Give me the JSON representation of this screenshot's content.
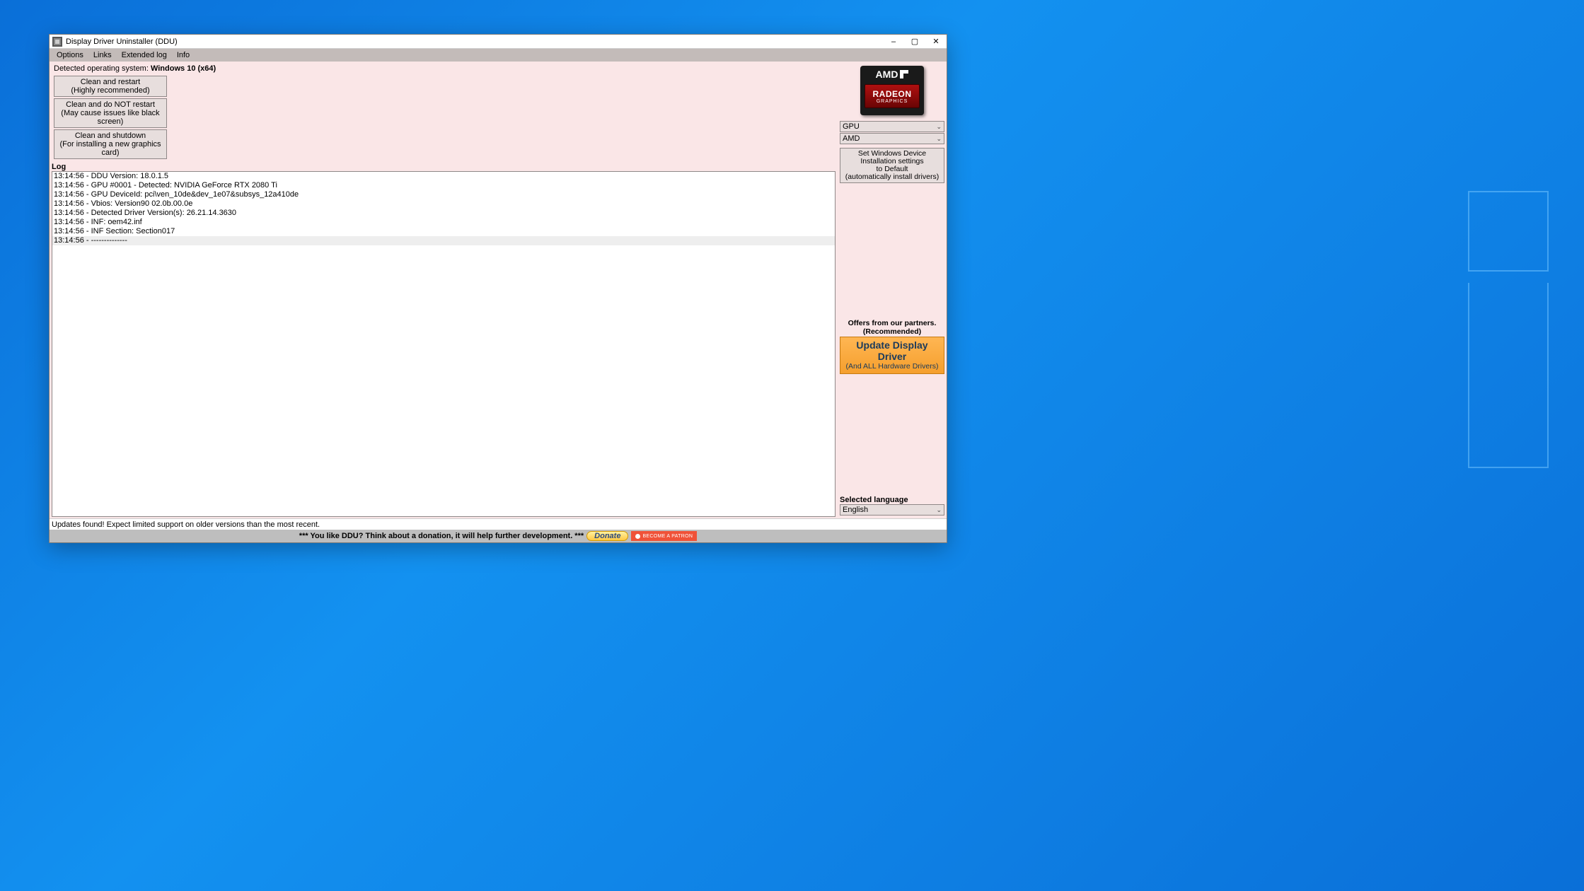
{
  "window": {
    "title": "Display Driver Uninstaller (DDU)"
  },
  "menu": {
    "options": "Options",
    "links": "Links",
    "extended_log": "Extended log",
    "info": "Info"
  },
  "os": {
    "label": "Detected operating system: ",
    "value": "Windows 10 (x64)"
  },
  "actions": {
    "btn1_l1": "Clean and restart",
    "btn1_l2": "(Highly recommended)",
    "btn2_l1": "Clean and do NOT restart",
    "btn2_l2": "(May cause issues like black screen)",
    "btn3_l1": "Clean and shutdown",
    "btn3_l2": "(For installing a new graphics card)"
  },
  "log": {
    "label": "Log",
    "entries": [
      "13:14:56 - DDU Version: 18.0.1.5",
      "13:14:56 - GPU #0001 - Detected: NVIDIA GeForce RTX 2080 Ti",
      "13:14:56 - GPU DeviceId: pci\\ven_10de&dev_1e07&subsys_12a410de",
      "13:14:56 - Vbios: Version90 02.0b.00.0e",
      "13:14:56 - Detected Driver Version(s): 26.21.14.3630",
      "13:14:56 - INF: oem42.inf",
      "13:14:56 - INF Section: Section017",
      "13:14:56 - --------------"
    ]
  },
  "sidebar": {
    "amd_top": "AMD",
    "amd_radeon": "RADEON",
    "amd_graphics": "GRAPHICS",
    "dd_device_type": "GPU",
    "dd_vendor": "AMD",
    "set_defaults_l1": "Set Windows Device Installation settings",
    "set_defaults_l2": "to Default",
    "set_defaults_l3": "(automatically install drivers)",
    "offers_label": "Offers from our partners. (Recommended)",
    "update_l1": "Update Display Driver",
    "update_l2": "(And ALL Hardware Drivers)",
    "lang_label": "Selected language",
    "lang_value": "English"
  },
  "status": {
    "text": "Updates found! Expect limited support on older versions than the most recent."
  },
  "footer": {
    "msg": "*** You like DDU? Think about a donation, it will help further development. ***",
    "donate": "Donate",
    "patreon": "BECOME A PATRON"
  }
}
